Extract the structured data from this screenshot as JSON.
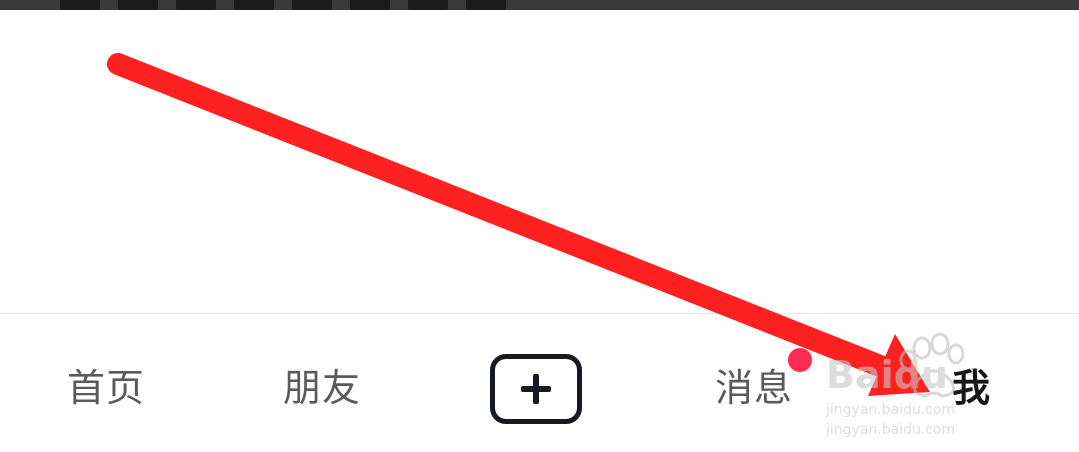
{
  "tab_bar": {
    "home_label": "首页",
    "friends_label": "朋友",
    "publish_icon": "plus-icon",
    "messages_label": "消息",
    "me_label": "我"
  },
  "colors": {
    "tab_text": "#5a5a5a",
    "tab_active": "#161616",
    "badge": "#fe2c55",
    "arrow": "#ff2020"
  },
  "watermark": {
    "brand": "Baidu",
    "url": "jingyan.baidu.com"
  }
}
